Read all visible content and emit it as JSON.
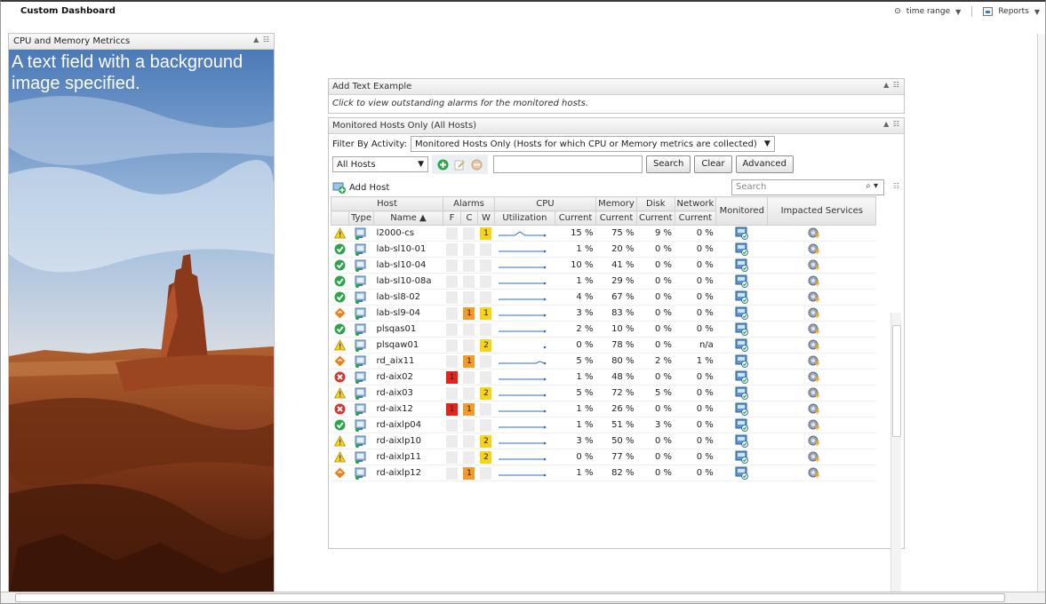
{
  "dashboard": {
    "title": "Custom Dashboard"
  },
  "toolbar": {
    "time_range_label": "time range",
    "reports_label": "Reports"
  },
  "left_panel": {
    "title": "CPU and Memory Metriccs",
    "text": "A text field with a background image specified."
  },
  "text_widget": {
    "title": "Add Text Example",
    "hint": "Click to view outstanding alarms for the monitored hosts."
  },
  "hosts_widget": {
    "title": "Monitored Hosts Only (All Hosts)",
    "filter_label": "Filter By Activity:",
    "filter_value": "Monitored Hosts Only (Hosts for which CPU or Memory metrics are collected)",
    "scope_value": "All Hosts",
    "search_button": "Search",
    "clear_button": "Clear",
    "advanced_button": "Advanced",
    "add_host_label": "Add Host",
    "search_placeholder": "Search",
    "group_headers": [
      "Host",
      "Alarms",
      "CPU",
      "Memory",
      "Disk",
      "Network",
      "Monitored",
      "Impacted Services"
    ],
    "column_headers": [
      "Type",
      "Name ▲",
      "F",
      "C",
      "W",
      "Utilization",
      "Current",
      "Current",
      "Current",
      "Current"
    ],
    "rows": [
      {
        "status": "warning",
        "name": "l2000-cs",
        "f": "",
        "c": "",
        "w": "1",
        "spark": "peak",
        "cpu": "15 %",
        "mem": "75 %",
        "disk": "9 %",
        "net": "0 %"
      },
      {
        "status": "ok",
        "name": "lab-sl10-01",
        "f": "",
        "c": "",
        "w": "",
        "spark": "flat",
        "cpu": "1 %",
        "mem": "20 %",
        "disk": "0 %",
        "net": "0 %"
      },
      {
        "status": "ok",
        "name": "lab-sl10-04",
        "f": "",
        "c": "",
        "w": "",
        "spark": "flat",
        "cpu": "10 %",
        "mem": "41 %",
        "disk": "0 %",
        "net": "0 %"
      },
      {
        "status": "ok",
        "name": "lab-sl10-08a",
        "f": "",
        "c": "",
        "w": "",
        "spark": "flat",
        "cpu": "1 %",
        "mem": "29 %",
        "disk": "0 %",
        "net": "0 %"
      },
      {
        "status": "ok",
        "name": "lab-sl8-02",
        "f": "",
        "c": "",
        "w": "",
        "spark": "flat",
        "cpu": "4 %",
        "mem": "67 %",
        "disk": "0 %",
        "net": "0 %"
      },
      {
        "status": "major",
        "name": "lab-sl9-04",
        "f": "",
        "c": "1",
        "w": "1",
        "spark": "flat",
        "cpu": "3 %",
        "mem": "83 %",
        "disk": "0 %",
        "net": "0 %"
      },
      {
        "status": "ok",
        "name": "plsqas01",
        "f": "",
        "c": "",
        "w": "",
        "spark": "flat",
        "cpu": "2 %",
        "mem": "10 %",
        "disk": "0 %",
        "net": "0 %"
      },
      {
        "status": "warning",
        "name": "plsqaw01",
        "f": "",
        "c": "",
        "w": "2",
        "spark": "none",
        "cpu": "0 %",
        "mem": "78 %",
        "disk": "0 %",
        "net": "n/a"
      },
      {
        "status": "major",
        "name": "rd_aix11",
        "f": "",
        "c": "1",
        "w": "",
        "spark": "tail",
        "cpu": "5 %",
        "mem": "80 %",
        "disk": "2 %",
        "net": "1 %"
      },
      {
        "status": "critical",
        "name": "rd-aix02",
        "f": "1",
        "c": "",
        "w": "",
        "spark": "flat",
        "cpu": "1 %",
        "mem": "48 %",
        "disk": "0 %",
        "net": "0 %"
      },
      {
        "status": "warning",
        "name": "rd-aix03",
        "f": "",
        "c": "",
        "w": "2",
        "spark": "flat",
        "cpu": "5 %",
        "mem": "72 %",
        "disk": "5 %",
        "net": "0 %"
      },
      {
        "status": "critical",
        "name": "rd-aix12",
        "f": "1",
        "c": "1",
        "w": "",
        "spark": "flat",
        "cpu": "1 %",
        "mem": "26 %",
        "disk": "0 %",
        "net": "0 %"
      },
      {
        "status": "ok",
        "name": "rd-aixlp04",
        "f": "",
        "c": "",
        "w": "",
        "spark": "flat",
        "cpu": "1 %",
        "mem": "51 %",
        "disk": "3 %",
        "net": "0 %"
      },
      {
        "status": "warning",
        "name": "rd-aixlp10",
        "f": "",
        "c": "",
        "w": "2",
        "spark": "flat",
        "cpu": "3 %",
        "mem": "50 %",
        "disk": "0 %",
        "net": "0 %"
      },
      {
        "status": "warning",
        "name": "rd-aixlp11",
        "f": "",
        "c": "",
        "w": "2",
        "spark": "flat",
        "cpu": "0 %",
        "mem": "77 %",
        "disk": "0 %",
        "net": "0 %"
      },
      {
        "status": "major",
        "name": "rd-aixlp12",
        "f": "",
        "c": "1",
        "w": "",
        "spark": "flat",
        "cpu": "1 %",
        "mem": "82 %",
        "disk": "0 %",
        "net": "0 %"
      }
    ]
  },
  "colors": {
    "fatal": "#e0251b",
    "critical": "#f39a2b",
    "warning": "#f7d417",
    "ok": "#2ca44a",
    "spark": "#2f6fb5"
  },
  "icons": {
    "status_ok": "green-check-circle-icon",
    "status_warning": "yellow-triangle-icon",
    "status_critical": "red-x-circle-icon",
    "status_major": "orange-diamond-icon",
    "type": "host-type-icon",
    "monitored": "monitored-icon",
    "impacted_services": "service-icon"
  }
}
